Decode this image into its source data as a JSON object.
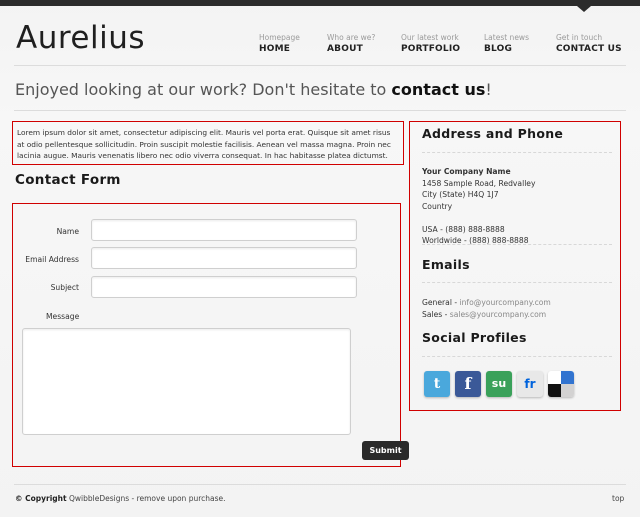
{
  "header": {
    "logo": "Aurelius",
    "nav": [
      {
        "sub": "Homepage",
        "label": "HOME"
      },
      {
        "sub": "Who are we?",
        "label": "ABOUT"
      },
      {
        "sub": "Our latest work",
        "label": "PORTFOLIO"
      },
      {
        "sub": "Latest news",
        "label": "BLOG"
      },
      {
        "sub": "Get in touch",
        "label": "CONTACT US"
      }
    ]
  },
  "tagline": {
    "text": "Enjoyed looking at our work? Don't hesitate to ",
    "link": "contact us",
    "end": "!"
  },
  "intro": "Lorem ipsum dolor sit amet, consectetur adipiscing elit. Mauris vel porta erat. Quisque sit amet risus at odio pellentesque sollicitudin. Proin suscipit molestie facilisis. Aenean vel massa magna. Proin nec lacinia augue. Mauris venenatis libero nec odio viverra consequat. In hac habitasse platea dictumst.",
  "form": {
    "title": "Contact Form",
    "name_label": "Name",
    "name_value": "",
    "email_label": "Email Address",
    "email_value": "",
    "subject_label": "Subject",
    "subject_value": "",
    "message_label": "Message",
    "message_value": "",
    "submit_label": "Submit"
  },
  "sidebar": {
    "address_title": "Address and Phone",
    "company": "Your Company Name",
    "address_line1": "1458 Sample Road, Redvalley",
    "address_line2": "City (State) H4Q 1J7",
    "address_line3": "Country",
    "phone_usa": "USA - (888) 888-8888",
    "phone_world": "Worldwide - (888) 888-8888",
    "emails_title": "Emails",
    "email_general_label": "General - ",
    "email_general": "info@yourcompany.com",
    "email_sales_label": "Sales - ",
    "email_sales": "sales@yourcompany.com",
    "social_title": "Social Profiles",
    "social": [
      {
        "name": "twitter-icon",
        "glyph": "t",
        "color": "#4aa8dc"
      },
      {
        "name": "facebook-icon",
        "glyph": "f",
        "color": "#3b5998"
      },
      {
        "name": "stumbleupon-icon",
        "glyph": "su",
        "color": "#3aa15a"
      },
      {
        "name": "flickr-icon",
        "glyph": "fr",
        "color": "#e8e8e8"
      },
      {
        "name": "delicious-icon",
        "glyph": "",
        "color": "#ffffff"
      }
    ]
  },
  "footer": {
    "copyright_label": "© Copyright",
    "copyright_text": " QwibbleDesigns - remove upon purchase.",
    "top_link": "top"
  }
}
